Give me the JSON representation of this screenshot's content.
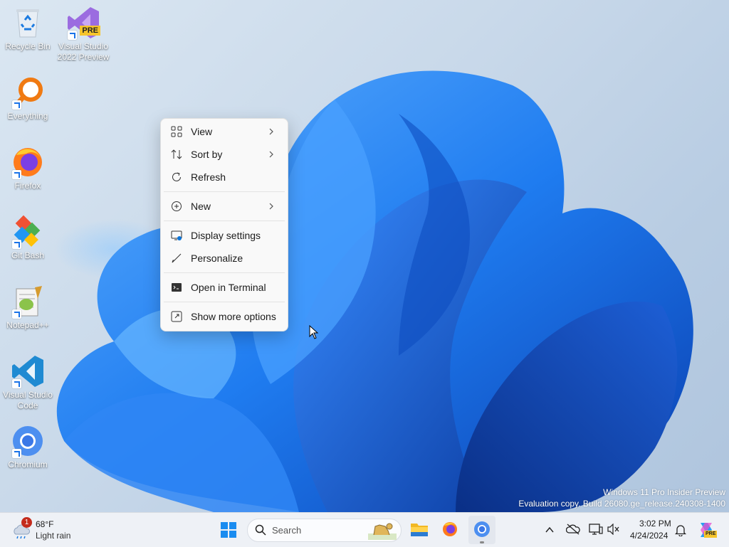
{
  "desktop": {
    "icons": [
      {
        "label1": "Recycle Bin",
        "label2": ""
      },
      {
        "label1": "Visual Studio",
        "label2": "2022 Preview",
        "badge": "PRE"
      },
      {
        "label1": "Everything",
        "label2": ""
      },
      {
        "label1": "Firefox",
        "label2": ""
      },
      {
        "label1": "Git Bash",
        "label2": ""
      },
      {
        "label1": "Notepad++",
        "label2": ""
      },
      {
        "label1": "Visual Studio",
        "label2": "Code"
      },
      {
        "label1": "Chromium",
        "label2": ""
      }
    ]
  },
  "context_menu": {
    "items": [
      {
        "label": "View",
        "icon": "view-grid-icon",
        "submenu": true
      },
      {
        "label": "Sort by",
        "icon": "sort-icon",
        "submenu": true
      },
      {
        "label": "Refresh",
        "icon": "refresh-icon",
        "submenu": false
      },
      {
        "label": "New",
        "icon": "plus-circle-icon",
        "submenu": true
      },
      {
        "label": "Display settings",
        "icon": "display-icon",
        "submenu": false
      },
      {
        "label": "Personalize",
        "icon": "brush-icon",
        "submenu": false
      },
      {
        "label": "Open in Terminal",
        "icon": "terminal-icon",
        "submenu": false
      },
      {
        "label": "Show more options",
        "icon": "more-options-icon",
        "submenu": false
      }
    ]
  },
  "watermark": {
    "line1": "Windows 11 Pro Insider Preview",
    "line2": "Evaluation copy. Build 26080.ge_release.240308-1400"
  },
  "taskbar": {
    "weather": {
      "temp": "68°F",
      "condition": "Light rain",
      "badge": "1"
    },
    "search_placeholder": "Search",
    "clock": {
      "time": "3:02 PM",
      "date": "4/24/2024"
    },
    "copilot_badge": "PRE"
  },
  "colors": {
    "accent": "#0a74da",
    "taskbar_bg": "#eef1f6",
    "menu_bg": "#f9f9f9"
  }
}
